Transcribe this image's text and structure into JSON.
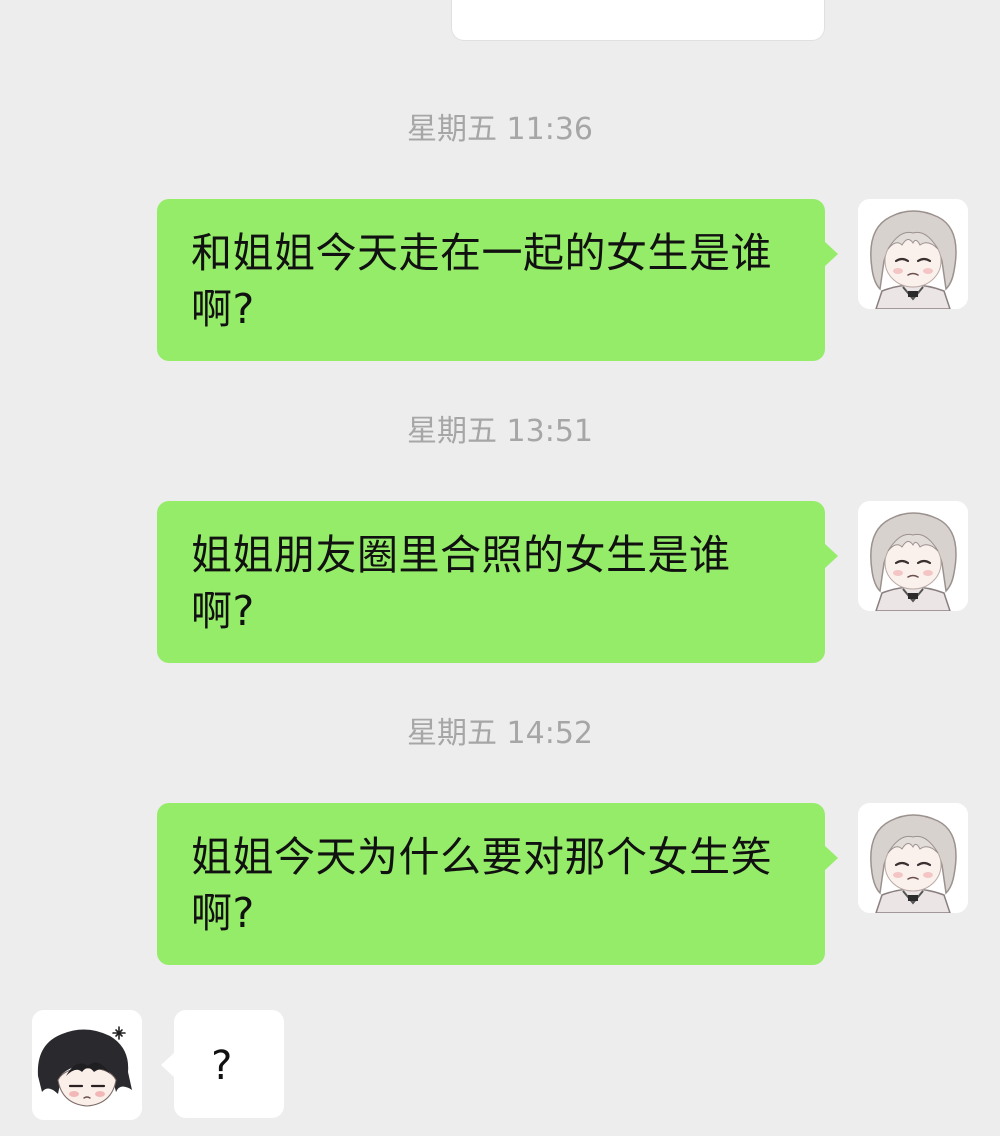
{
  "messages": [
    {
      "timestamp": "星期五 11:36",
      "text": "和姐姐今天走在一起的女生是谁啊?"
    },
    {
      "timestamp": "星期五 13:51",
      "text": "姐姐朋友圈里合照的女生是谁啊?"
    },
    {
      "timestamp": "星期五 14:52",
      "text": "姐姐今天为什么要对那个女生笑啊?"
    }
  ],
  "reply": {
    "text": "?"
  },
  "avatars": {
    "self_icon": "light-haired-chibi-avatar-icon",
    "contact_icon": "dark-haired-chibi-avatar-icon"
  },
  "colors": {
    "background": "#ededed",
    "outgoing_bubble": "#95ec69",
    "incoming_bubble": "#ffffff",
    "timestamp_text": "#a6a6a6",
    "message_text": "#111111"
  }
}
